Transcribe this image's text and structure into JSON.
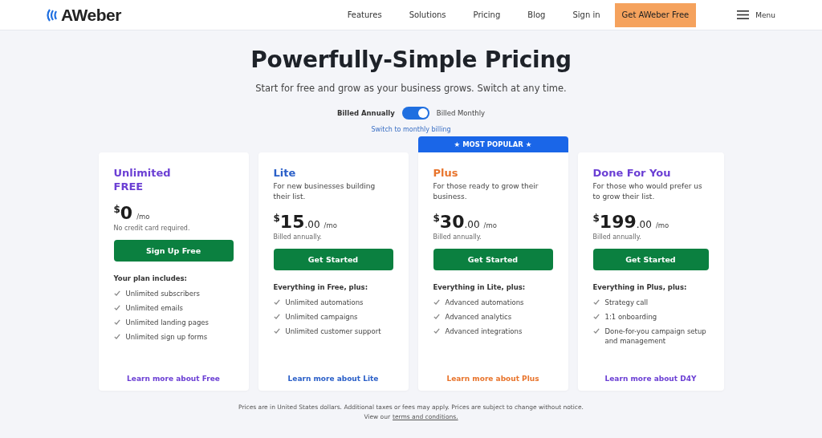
{
  "header": {
    "logo_text": "AWeber",
    "nav": [
      "Features",
      "Solutions",
      "Pricing",
      "Blog",
      "Sign in"
    ],
    "cta": "Get AWeber Free",
    "menu": "Menu"
  },
  "hero": {
    "title": "Powerfully-Simple Pricing",
    "subtitle": "Start for free and grow as your business grows. Switch at any time."
  },
  "billing_toggle": {
    "label_left": "Billed Annually",
    "label_right": "Billed Monthly",
    "on": true,
    "link": "Switch to monthly billing"
  },
  "plans": [
    {
      "name": "Unlimited\nFREE",
      "color": "#6b3fd4",
      "popular": false,
      "currency": "$",
      "amount": "0",
      "period": "/mo",
      "note": "No credit card required.",
      "button": "Sign Up Free",
      "features_heading": "Your plan includes:",
      "features": [
        "Unlimited subscribers",
        "Unlimited emails",
        "Unlimited landing pages",
        "Unlimited sign up forms"
      ],
      "link": "Learn more about Free"
    },
    {
      "name": "Lite",
      "color": "#2a5fc8",
      "popular": false,
      "subtitle": "For new businesses building their list.",
      "currency": "$",
      "amount": "15",
      "cents": ".00",
      "period": "/mo",
      "note": "Billed annually.",
      "button": "Get Started",
      "features_heading": "Everything in Free, plus:",
      "features": [
        "Unlimited automations",
        "Unlimited campaigns",
        "Unlimited customer support"
      ],
      "link": "Learn more about Lite"
    },
    {
      "name": "Plus",
      "color": "#e8742c",
      "popular": true,
      "badge": "★ MOST POPULAR ★",
      "subtitle": "For those ready to grow their business.",
      "currency": "$",
      "amount": "30",
      "cents": ".00",
      "period": "/mo",
      "note": "Billed annually.",
      "button": "Get Started",
      "features_heading": "Everything in Lite, plus:",
      "features": [
        "Advanced automations",
        "Advanced analytics",
        "Advanced integrations"
      ],
      "link": "Learn more about Plus"
    },
    {
      "name": "Done For You",
      "color": "#6b3fd4",
      "popular": false,
      "subtitle": "For those who would prefer us to grow their list.",
      "currency": "$",
      "amount": "199",
      "cents": ".00",
      "period": "/mo",
      "note": "Billed annually.",
      "button": "Get Started",
      "features_heading": "Everything in Plus, plus:",
      "features": [
        "Strategy call",
        "1:1 onboarding",
        "Done-for-you campaign setup and management"
      ],
      "link": "Learn more about D4Y"
    }
  ],
  "footer": {
    "notice": "Prices are in United States dollars. Additional taxes or fees may apply. Prices are subject to change without notice.",
    "view_prefix": "View our",
    "terms_link": "terms and conditions."
  }
}
